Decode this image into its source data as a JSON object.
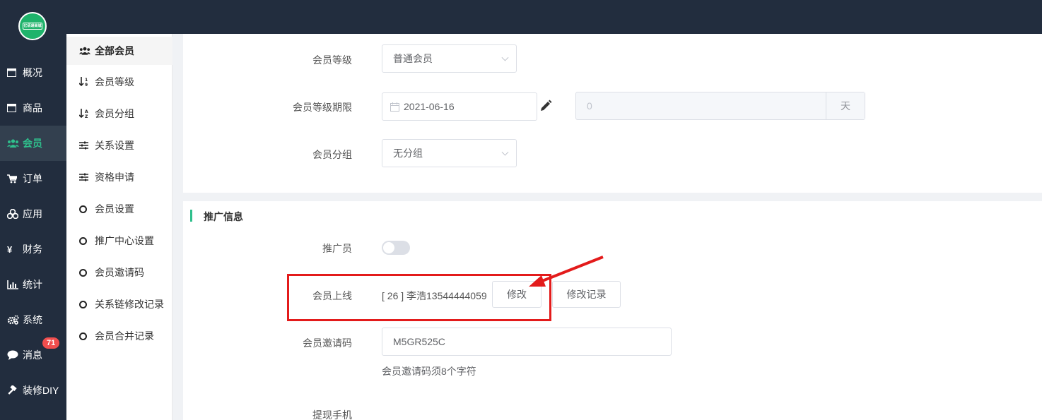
{
  "logo": {
    "text": "亿佰通商城"
  },
  "nav": {
    "items": [
      {
        "label": "概况",
        "icon": "window-icon"
      },
      {
        "label": "商品",
        "icon": "box-icon"
      },
      {
        "label": "会员",
        "icon": "users-icon"
      },
      {
        "label": "订单",
        "icon": "cart-icon"
      },
      {
        "label": "应用",
        "icon": "cubes-icon"
      },
      {
        "label": "财务",
        "icon": "yen-icon"
      },
      {
        "label": "统计",
        "icon": "bar-chart-icon"
      },
      {
        "label": "系统",
        "icon": "gears-icon"
      },
      {
        "label": "消息",
        "icon": "chat-icon"
      },
      {
        "label": "装修DIY",
        "icon": "hammer-icon"
      }
    ],
    "message_badge": "71"
  },
  "subnav": {
    "items": [
      {
        "label": "全部会员",
        "icon": "users-icon"
      },
      {
        "label": "会员等级",
        "icon": "sort-numeric-icon"
      },
      {
        "label": "会员分组",
        "icon": "sort-alpha-icon"
      },
      {
        "label": "关系设置",
        "icon": "sliders-icon"
      },
      {
        "label": "资格申请",
        "icon": "sliders-icon"
      },
      {
        "label": "会员设置",
        "icon": "circle-icon"
      },
      {
        "label": "推广中心设置",
        "icon": "circle-icon"
      },
      {
        "label": "会员邀请码",
        "icon": "circle-icon"
      },
      {
        "label": "关系链修改记录",
        "icon": "circle-icon"
      },
      {
        "label": "会员合并记录",
        "icon": "circle-icon"
      }
    ]
  },
  "form": {
    "level_label": "会员等级",
    "level_value": "普通会员",
    "expiry_label": "会员等级期限",
    "expiry_date": "2021-06-16",
    "expiry_days_value": "0",
    "expiry_days_unit": "天",
    "group_label": "会员分组",
    "group_value": "无分组"
  },
  "promo": {
    "section_title": "推广信息",
    "promoter_label": "推广员",
    "promoter_enabled": false,
    "upline_label": "会员上线",
    "upline_value": "[ 26 ] 李浩13544444059",
    "modify_button": "修改",
    "history_button": "修改记录",
    "invite_label": "会员邀请码",
    "invite_value": "M5GR525C",
    "invite_hint": "会员邀请码须8个字符",
    "withdraw_phone_label": "提现手机"
  },
  "colors": {
    "nav_bg": "#222d3e",
    "accent": "#2fbf8c",
    "annotation": "#e31b1b",
    "badge": "#f04e4e"
  }
}
